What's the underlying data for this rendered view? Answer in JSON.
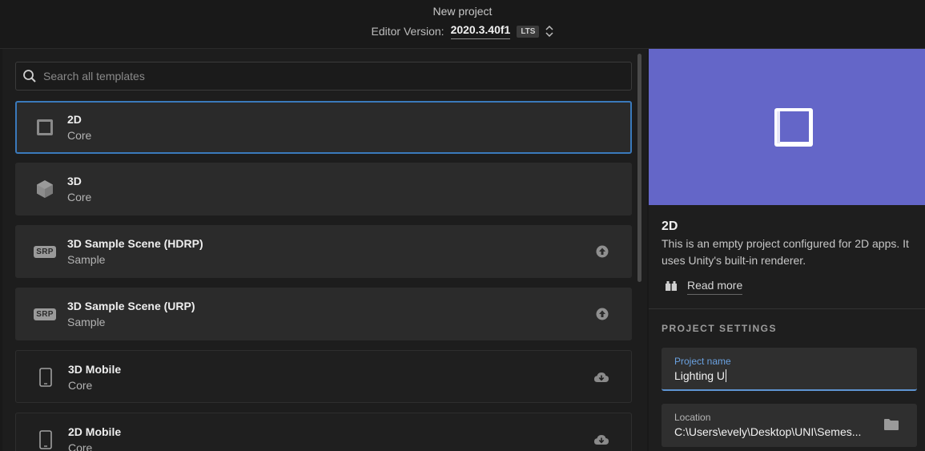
{
  "header": {
    "title": "New project",
    "version_label": "Editor Version:",
    "version_value": "2020.3.40f1",
    "lts_badge": "LTS"
  },
  "search": {
    "placeholder": "Search all templates",
    "value": ""
  },
  "templates": [
    {
      "name": "2D",
      "category": "Core",
      "icon": "square-2d-icon",
      "action": "none",
      "selected": true
    },
    {
      "name": "3D",
      "category": "Core",
      "icon": "cube-3d-icon",
      "action": "none",
      "selected": false
    },
    {
      "name": "3D Sample Scene (HDRP)",
      "category": "Sample",
      "icon": "srp-icon",
      "icon_text": "SRP",
      "action": "upgrade-icon",
      "selected": false
    },
    {
      "name": "3D Sample Scene (URP)",
      "category": "Sample",
      "icon": "srp-icon",
      "icon_text": "SRP",
      "action": "upgrade-icon",
      "selected": false
    },
    {
      "name": "3D Mobile",
      "category": "Core",
      "icon": "phone-icon",
      "action": "cloud-download-icon",
      "selected": false
    },
    {
      "name": "2D Mobile",
      "category": "Core",
      "icon": "phone-icon",
      "action": "cloud-download-icon",
      "selected": false
    }
  ],
  "detail": {
    "title": "2D",
    "description": "This is an empty project configured for 2D apps. It uses Unity's built-in renderer.",
    "read_more": "Read more"
  },
  "settings": {
    "section_title": "PROJECT SETTINGS",
    "project_name_label": "Project name",
    "project_name_value": "Lighting U",
    "location_label": "Location",
    "location_value": "C:\\Users\\evely\\Desktop\\UNI\\Semes..."
  },
  "colors": {
    "accent": "#3a79bb",
    "preview_bg": "#6466c8",
    "field_focus": "#5e94d2"
  }
}
